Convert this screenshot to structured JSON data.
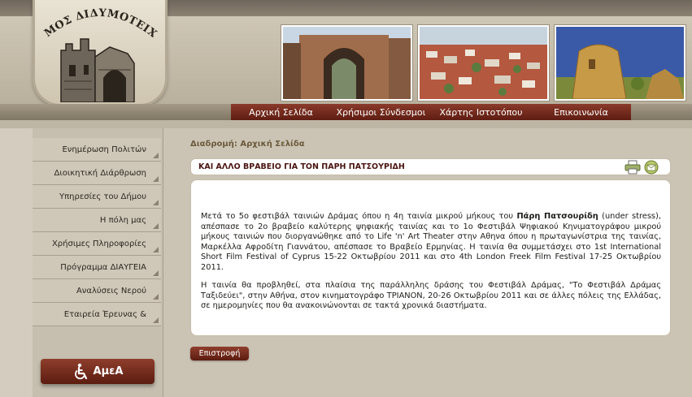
{
  "header": {
    "logo_text": "ΔΗΜΟΣ ΔΙΔΥΜΟΤΕΙΧΟΥ",
    "photos": [
      "castle-arch-photo",
      "town-rooftops-photo",
      "tower-ruin-photo"
    ]
  },
  "nav": {
    "items": [
      "Αρχική Σελίδα",
      "Χρήσιμοι Σύνδεσμοι",
      "Χάρτης Ιστοτόπου",
      "Επικοινωνία"
    ]
  },
  "sidebar": {
    "items": [
      {
        "label": "Ενημέρωση Πολιτών"
      },
      {
        "label": "Διοικητική Διάρθρωση"
      },
      {
        "label": "Υπηρεσίες του Δήμου"
      },
      {
        "label": "Η πόλη μας"
      },
      {
        "label": "Χρήσιμες Πληροφορίες"
      },
      {
        "label": "Πρόγραμμα ΔΙΑΥΓΕΙΑ"
      },
      {
        "label": "Αναλύσεις Νερού"
      },
      {
        "label": "Εταιρεία Έρευνας &"
      }
    ],
    "amea_label": "ΑμεΑ"
  },
  "main": {
    "breadcrumb": "Διαδρομή: Αρχική Σελίδα",
    "article_title": "ΚΑΙ ΑΛΛΟ ΒΡΑΒΕΙΟ ΓΙΑ ΤΟΝ ΠΑΡΗ ΠΑΤΣΟΥΡΙΔΗ",
    "p1_before": "Μετά το 5ο φεστιβάλ ταινιών Δράμας όπου η 4η ταινία μικρού μήκους του ",
    "p1_bold": "Πάρη Πατσουρίδη",
    "p1_after": " (under stress), απέσπασε το 2ο βραβείο καλύτερης ψηφιακής ταινίας και το 1ο Φεστιβάλ Ψηφιακού Κηνιματογράφου μικρού μήκους ταινιών που διοργανώθηκε από το Life 'n' Art Theater στην Αθηνα όπου η πρωταγωνίστρια της ταινίας, Μαρκέλλα Αφροδίτη Γιαννάτου, απέσπασε το Βραβείο Ερμηνίας. Η ταινία θα συμμετάσχει στο 1st International Short Film Festival of Cyprus 15-22 Οκτωβρίου 2011 και στο 4th London Freek Film Festival 17-25 Οκτωβρίου 2011.",
    "p2": "Η ταινία θα προβληθεί, στα πλαίσια της παράλληλης δράσης του Φεστιβάλ Δράμας, \"Το Φεστιβάλ Δράμας Ταξιδεύει\", στην Αθήνα, στον κινηματογράφο ΤΡΙΑΝΟΝ, 20-26 Οκτωβρίου 2011 και σε άλλες πόλεις της Ελλάδας, σε ημερομηνίες που θα ανακοινώνονται σε τακτά χρονικά διαστήματα.",
    "back_label": "Επιστροφή"
  },
  "icons": {
    "print": "printer-icon",
    "email": "email-icon",
    "wheelchair": "wheelchair-icon"
  }
}
